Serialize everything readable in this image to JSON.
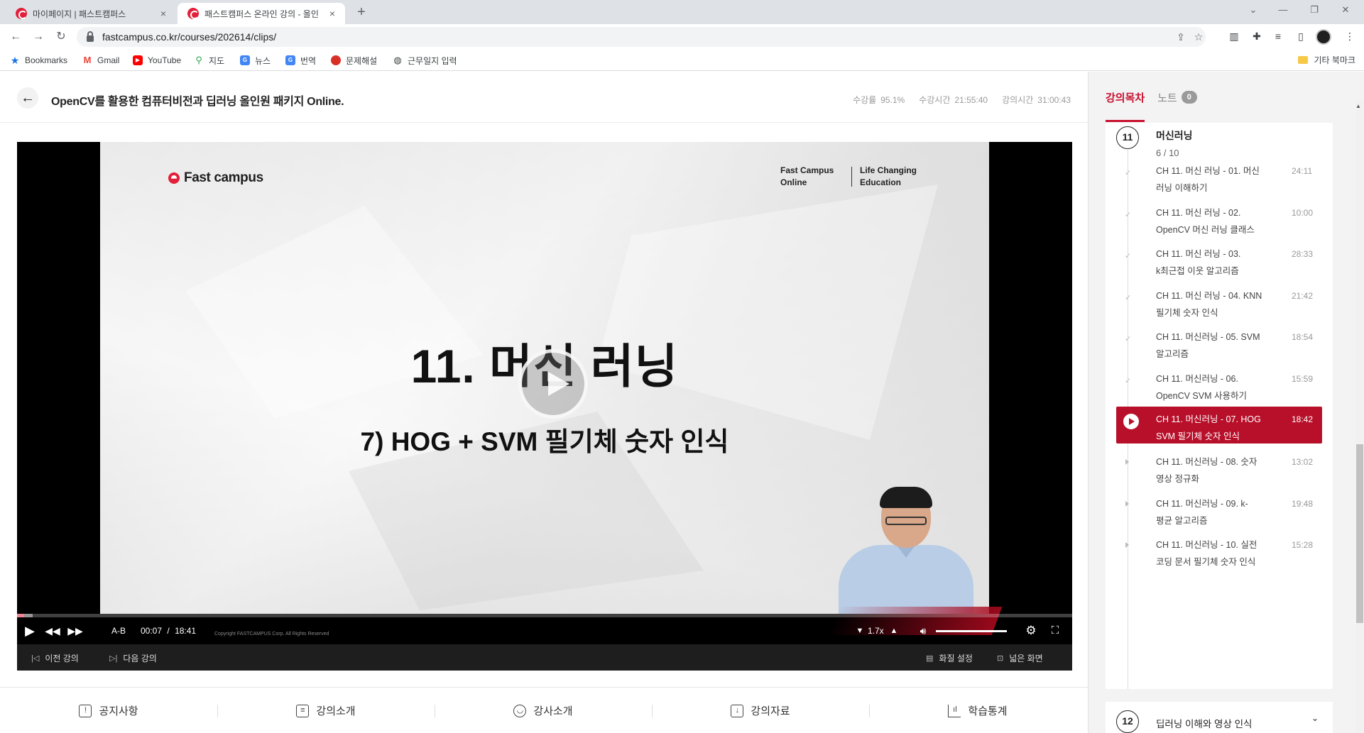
{
  "browser": {
    "tabs": [
      {
        "title": "마이페이지 | 패스트캠퍼스",
        "close": "×"
      },
      {
        "title": "패스트캠퍼스 온라인 강의 - 올인",
        "close": "×"
      }
    ],
    "new_tab": "+",
    "url": "fastcampus.co.kr/courses/202614/clips/",
    "bookmarks": [
      {
        "label": "Bookmarks",
        "icon": "star-icon",
        "color": "#1a73e8"
      },
      {
        "label": "Gmail",
        "icon": "gmail-icon",
        "color": "#ea4335"
      },
      {
        "label": "YouTube",
        "icon": "youtube-icon",
        "color": "#ff0000"
      },
      {
        "label": "지도",
        "icon": "maps-icon",
        "color": "#34a853"
      },
      {
        "label": "뉴스",
        "icon": "news-icon",
        "color": "#4285f4"
      },
      {
        "label": "번역",
        "icon": "translate-icon",
        "color": "#4285f4"
      },
      {
        "label": "문제해설",
        "icon": "bookmark-site-icon",
        "color": "#d93025"
      },
      {
        "label": "근무일지 입력",
        "icon": "globe-icon",
        "color": "#3c4043"
      }
    ],
    "other_bookmarks": "기타 북마크"
  },
  "header": {
    "course_title": "OpenCV를 활용한 컴퓨터비전과 딥러닝 올인원 패키지 Online.",
    "stats": [
      {
        "label": "수강률",
        "value": "95.1%"
      },
      {
        "label": "수강시간",
        "value": "21:55:40"
      },
      {
        "label": "강의시간",
        "value": "31:00:43"
      }
    ]
  },
  "player": {
    "slide": {
      "logo": "Fast campus",
      "tag1_line1": "Fast Campus",
      "tag1_line2": "Online",
      "tag2_line1": "Life Changing",
      "tag2_line2": "Education",
      "heading": "11. 머신 러닝",
      "subheading": "7) HOG + SVM 필기체 숫자 인식"
    },
    "progress_fraction": 0.007,
    "ab_label": "A-B",
    "current_time": "00:07",
    "separator": "/",
    "duration": "18:41",
    "copyright": "Copyright FASTCAMPUS Corp. All Rights Reserved",
    "speed": "1.7x",
    "prev_label": "이전 강의",
    "next_label": "다음 강의",
    "quality_label": "화질 설정",
    "wide_label": "넓은 화면"
  },
  "bottom_tabs": [
    {
      "label": "공지사항",
      "icon": "notice-icon"
    },
    {
      "label": "강의소개",
      "icon": "clipboard-icon"
    },
    {
      "label": "강사소개",
      "icon": "user-icon"
    },
    {
      "label": "강의자료",
      "icon": "download-doc-icon"
    },
    {
      "label": "학습통계",
      "icon": "stats-icon"
    }
  ],
  "sidebar": {
    "tab_toc": "강의목차",
    "tab_notes": "노트",
    "notes_count": "0",
    "chapter": {
      "number": "11",
      "title": "머신러닝",
      "progress": "6 / 10"
    },
    "clips": [
      {
        "line1": "CH 11. 머신 러닝 - 01. 머신",
        "line2": "러닝 이해하기",
        "time": "24:11",
        "state": "done"
      },
      {
        "line1": "CH 11. 머신 러닝 - 02.",
        "line2": "OpenCV 머신 러닝 클래스",
        "time": "10:00",
        "state": "done"
      },
      {
        "line1": "CH 11. 머신 러닝 - 03.",
        "line2": "k최근접 이웃 알고리즘",
        "time": "28:33",
        "state": "done"
      },
      {
        "line1": "CH 11. 머신 러닝 - 04. KNN",
        "line2": "필기체 숫자 인식",
        "time": "21:42",
        "state": "done"
      },
      {
        "line1": "CH 11. 머신러닝 - 05. SVM",
        "line2": "알고리즘",
        "time": "18:54",
        "state": "done"
      },
      {
        "line1": "CH 11. 머신러닝 - 06.",
        "line2": "OpenCV SVM 사용하기",
        "time": "15:59",
        "state": "done"
      },
      {
        "line1": "CH 11. 머신러닝 - 07. HOG",
        "line2": "SVM 필기체 숫자 인식",
        "time": "18:42",
        "state": "active"
      },
      {
        "line1": "CH 11. 머신러닝 - 08. 숫자",
        "line2": "영상 정규화",
        "time": "13:02",
        "state": "todo"
      },
      {
        "line1": "CH 11. 머신러닝 - 09. k-",
        "line2": "평균 알고리즘",
        "time": "19:48",
        "state": "todo"
      },
      {
        "line1": "CH 11. 머신러닝 - 10. 실전",
        "line2": "코딩 문서 필기체 숫자 인식",
        "time": "15:28",
        "state": "todo"
      }
    ],
    "next_chapter": {
      "number": "12",
      "title": "딥러닝 이해와 영상 인식"
    }
  },
  "colors": {
    "brand": "#c8102e",
    "active_clip": "#b8102a",
    "progress": "#e2203a"
  }
}
